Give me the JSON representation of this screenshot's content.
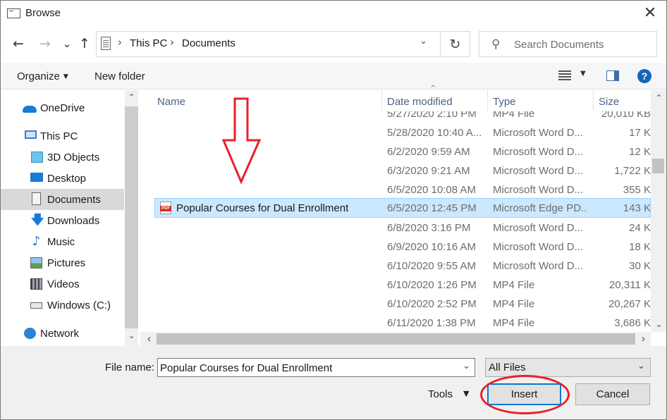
{
  "window": {
    "title": "Browse",
    "close_glyph": "✕"
  },
  "nav": {
    "back_glyph": "←",
    "forward_glyph": "→",
    "recent_glyph": "⌄",
    "up_glyph": "↑",
    "breadcrumb": [
      "This PC",
      "Documents"
    ],
    "breadcrumb_sep": "›",
    "dropdown_glyph": "⌄",
    "refresh_glyph": "↻",
    "search_placeholder": "Search Documents",
    "search_glyph": "⚲"
  },
  "toolbar": {
    "organize": "Organize",
    "organize_caret": "▼",
    "new_folder": "New folder",
    "view_caret": "▼",
    "help": "?"
  },
  "sidebar": {
    "items": [
      {
        "label": "OneDrive",
        "icon": "onedrive-icon"
      },
      {
        "label": "This PC",
        "icon": "this-pc-icon"
      },
      {
        "label": "3D Objects",
        "icon": "3d-objects-icon"
      },
      {
        "label": "Desktop",
        "icon": "desktop-icon"
      },
      {
        "label": "Documents",
        "icon": "documents-icon",
        "selected": true
      },
      {
        "label": "Downloads",
        "icon": "downloads-icon"
      },
      {
        "label": "Music",
        "icon": "music-icon"
      },
      {
        "label": "Pictures",
        "icon": "pictures-icon"
      },
      {
        "label": "Videos",
        "icon": "videos-icon"
      },
      {
        "label": "Windows (C:)",
        "icon": "drive-icon"
      },
      {
        "label": "Network",
        "icon": "network-icon"
      }
    ],
    "download_glyph": "🡇",
    "music_glyph": "♪",
    "scroll_up": "⌃",
    "scroll_down": "⌄"
  },
  "columns": {
    "name": "Name",
    "date": "Date modified",
    "type": "Type",
    "size": "Size",
    "sort_glyph": "^"
  },
  "files": [
    {
      "name": "",
      "date": "5/27/2020 2:10 PM",
      "type": "MP4 File",
      "size": "20,010 KB"
    },
    {
      "name": "",
      "date": "5/28/2020 10:40 A...",
      "type": "Microsoft Word D...",
      "size": "17 K"
    },
    {
      "name": "",
      "date": "6/2/2020 9:59 AM",
      "type": "Microsoft Word D...",
      "size": "12 K"
    },
    {
      "name": "",
      "date": "6/3/2020 9:21 AM",
      "type": "Microsoft Word D...",
      "size": "1,722 K"
    },
    {
      "name": "",
      "date": "6/5/2020 10:08 AM",
      "type": "Microsoft Word D...",
      "size": "355 K"
    },
    {
      "name": "Popular Courses for Dual Enrollment",
      "date": "6/5/2020 12:45 PM",
      "type": "Microsoft Edge PD...",
      "size": "143 K",
      "selected": true,
      "badge": "PDF"
    },
    {
      "name": "",
      "date": "6/8/2020 3:16 PM",
      "type": "Microsoft Word D...",
      "size": "24 K"
    },
    {
      "name": "",
      "date": "6/9/2020 10:16 AM",
      "type": "Microsoft Word D...",
      "size": "18 K"
    },
    {
      "name": "",
      "date": "6/10/2020 9:55 AM",
      "type": "Microsoft Word D...",
      "size": "30 K"
    },
    {
      "name": "",
      "date": "6/10/2020 1:26 PM",
      "type": "MP4 File",
      "size": "20,311 K"
    },
    {
      "name": "",
      "date": "6/10/2020 2:52 PM",
      "type": "MP4 File",
      "size": "20,267 K"
    },
    {
      "name": "",
      "date": "6/11/2020 1:38 PM",
      "type": "MP4 File",
      "size": "3,686 K"
    }
  ],
  "scroll": {
    "up": "⌃",
    "down": "⌄",
    "left": "‹",
    "right": "›"
  },
  "bottom": {
    "file_name_label": "File name:",
    "file_name_value": "Popular Courses for Dual Enrollment",
    "file_name_dd": "⌄",
    "file_type": "All Files",
    "file_type_dd": "⌄",
    "tools": "Tools",
    "tools_caret": "▼",
    "insert": "Insert",
    "cancel": "Cancel"
  },
  "colors": {
    "accent": "#0078d7",
    "selection": "#cce8ff",
    "annotation": "#e8202a"
  }
}
